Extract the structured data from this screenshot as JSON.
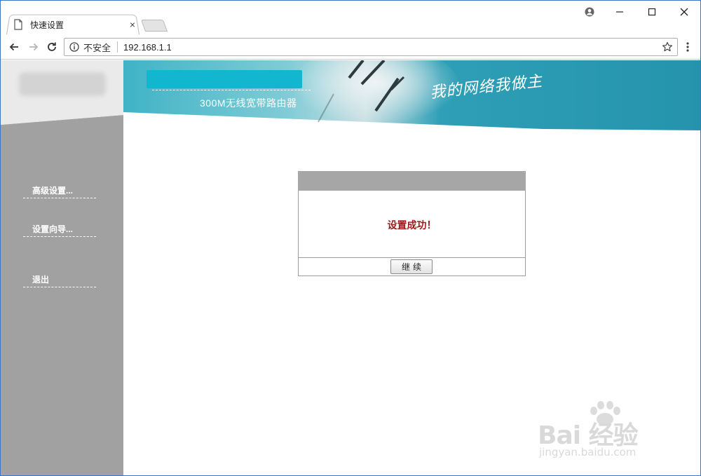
{
  "browser": {
    "tab_title": "快速设置",
    "tab_close": "×",
    "security_label": "不安全",
    "url": "192.168.1.1"
  },
  "banner": {
    "subtitle": "300M无线宽带路由器",
    "slogan": "我的网络我做主"
  },
  "sidebar": {
    "items": [
      {
        "label": "高级设置..."
      },
      {
        "label": "设置向导..."
      },
      {
        "label": "退出"
      }
    ]
  },
  "dialog": {
    "message": "设置成功！",
    "button_label": "继续"
  },
  "watermark": {
    "brand": "Bai 经验",
    "url": "jingyan.baidu.com"
  },
  "colors": {
    "sidebar_gray": "#a1a1a1",
    "banner_teal": "#2b9db5",
    "message_red": "#9b1a1a",
    "window_border": "#3b78c4"
  },
  "icons": [
    "page-icon",
    "back-arrow-icon",
    "forward-arrow-icon",
    "reload-icon",
    "info-icon",
    "star-icon",
    "kebab-menu-icon",
    "profile-icon",
    "minimize-icon",
    "maximize-icon",
    "close-icon"
  ]
}
